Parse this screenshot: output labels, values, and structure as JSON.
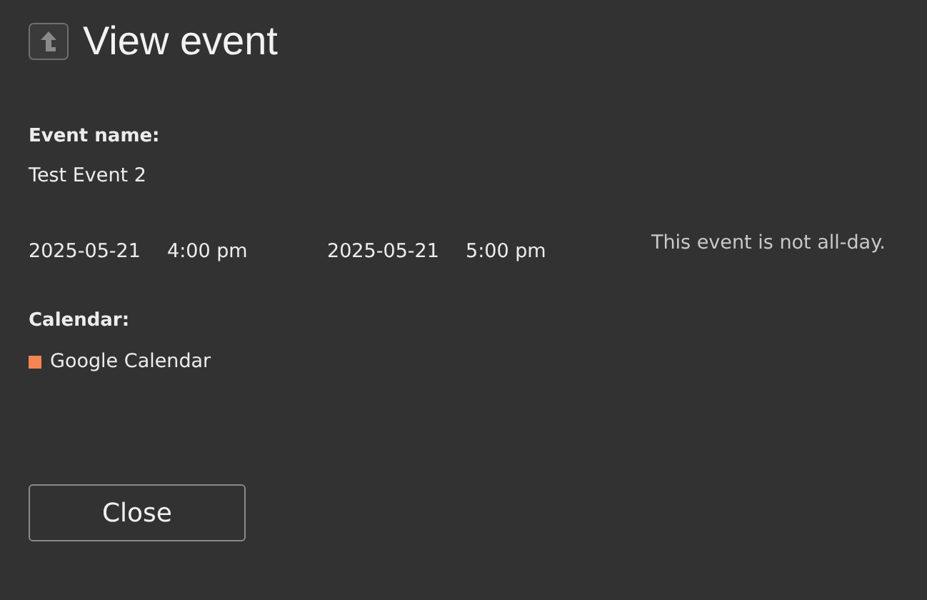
{
  "title": "View event",
  "event_name": {
    "label": "Event name:",
    "value": "Test Event 2"
  },
  "start": {
    "date": "2025-05-21",
    "time": "4:00 pm"
  },
  "end": {
    "date": "2025-05-21",
    "time": "5:00 pm"
  },
  "all_day_note": "This event is not all-day.",
  "calendar": {
    "label": "Calendar:",
    "name": "Google Calendar",
    "color": "#f58653"
  },
  "buttons": [
    "Close"
  ]
}
